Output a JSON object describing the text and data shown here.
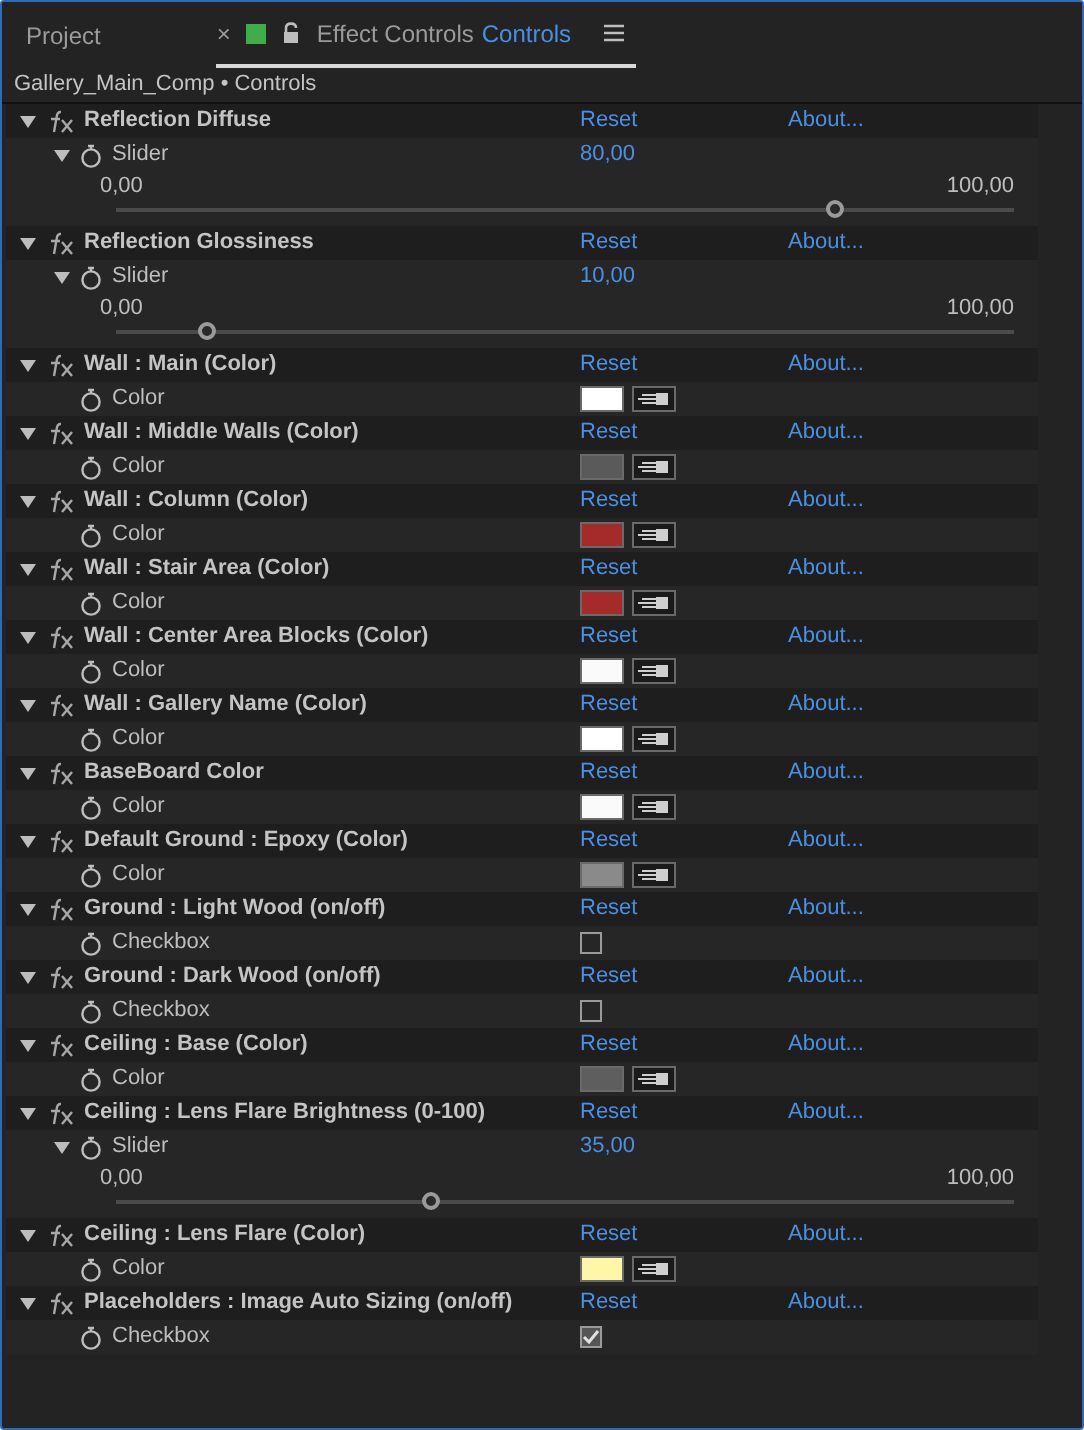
{
  "tabs": [
    {
      "label": "Project",
      "selected": false
    },
    {
      "label": "Effect Controls",
      "sublabel": "Controls",
      "selected": true
    }
  ],
  "close": "×",
  "breadcrumb": "Gallery_Main_Comp • Controls",
  "effects": [
    {
      "name": "Reflection Diffuse",
      "expanded": true,
      "reset": "Reset",
      "about": "About...",
      "param": {
        "kind": "slider",
        "label": "Slider",
        "value": "80,00",
        "min": "0,00",
        "max": "100,00",
        "level": 0.8
      }
    },
    {
      "name": "Reflection Glossiness",
      "expanded": true,
      "reset": "Reset",
      "about": "About...",
      "param": {
        "kind": "slider",
        "label": "Slider",
        "value": "10,00",
        "min": "0,00",
        "max": "100,00",
        "level": 0.1
      }
    },
    {
      "name": "Wall : Main (Color)",
      "expanded": true,
      "reset": "Reset",
      "about": "About...",
      "param": {
        "kind": "color",
        "label": "Color",
        "color": "#ffffff"
      }
    },
    {
      "name": "Wall : Middle Walls (Color)",
      "expanded": true,
      "reset": "Reset",
      "about": "About...",
      "param": {
        "kind": "color",
        "label": "Color",
        "color": "#5a5a5a"
      }
    },
    {
      "name": "Wall : Column (Color)",
      "expanded": true,
      "reset": "Reset",
      "about": "About...",
      "param": {
        "kind": "color",
        "label": "Color",
        "color": "#a52a2a"
      }
    },
    {
      "name": "Wall : Stair Area (Color)",
      "expanded": true,
      "reset": "Reset",
      "about": "About...",
      "param": {
        "kind": "color",
        "label": "Color",
        "color": "#a52a2a"
      }
    },
    {
      "name": "Wall : Center Area Blocks (Color)",
      "expanded": true,
      "reset": "Reset",
      "about": "About...",
      "param": {
        "kind": "color",
        "label": "Color",
        "color": "#fafafa"
      }
    },
    {
      "name": "Wall : Gallery Name (Color)",
      "expanded": true,
      "reset": "Reset",
      "about": "About...",
      "param": {
        "kind": "color",
        "label": "Color",
        "color": "#ffffff"
      }
    },
    {
      "name": "BaseBoard Color",
      "expanded": true,
      "reset": "Reset",
      "about": "About...",
      "param": {
        "kind": "color",
        "label": "Color",
        "color": "#fafafa"
      }
    },
    {
      "name": "Default Ground : Epoxy (Color)",
      "expanded": true,
      "reset": "Reset",
      "about": "About...",
      "param": {
        "kind": "color",
        "label": "Color",
        "color": "#8a8a8a"
      }
    },
    {
      "name": "Ground : Light Wood (on/off)",
      "expanded": true,
      "reset": "Reset",
      "about": "About...",
      "param": {
        "kind": "checkbox",
        "label": "Checkbox",
        "checked": false
      }
    },
    {
      "name": "Ground : Dark Wood (on/off)",
      "expanded": true,
      "reset": "Reset",
      "about": "About...",
      "param": {
        "kind": "checkbox",
        "label": "Checkbox",
        "checked": false
      }
    },
    {
      "name": "Ceiling : Base (Color)",
      "expanded": true,
      "reset": "Reset",
      "about": "About...",
      "param": {
        "kind": "color",
        "label": "Color",
        "color": "#5e5e5e"
      }
    },
    {
      "name": "Ceiling : Lens Flare Brightness (0-100)",
      "expanded": true,
      "reset": "Reset",
      "about": "About...",
      "param": {
        "kind": "slider",
        "label": "Slider",
        "value": "35,00",
        "min": "0,00",
        "max": "100,00",
        "level": 0.35
      }
    },
    {
      "name": "Ceiling : Lens Flare (Color)",
      "expanded": true,
      "reset": "Reset",
      "about": "About...",
      "param": {
        "kind": "color",
        "label": "Color",
        "color": "#fff6a8"
      }
    },
    {
      "name": "Placeholders : Image Auto Sizing (on/off)",
      "expanded": true,
      "reset": "Reset",
      "about": "About...",
      "param": {
        "kind": "checkbox",
        "label": "Checkbox",
        "checked": true
      }
    }
  ]
}
